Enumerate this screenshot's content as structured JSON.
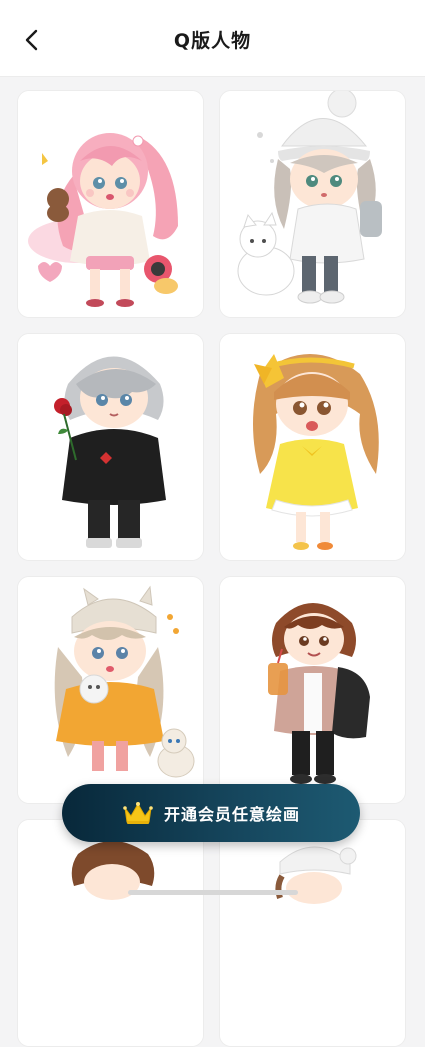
{
  "header": {
    "title": "Q版人物",
    "back_icon": "chevron-left-icon"
  },
  "gallery": {
    "items": [
      {
        "name": "pink-hair-girl-with-teddy"
      },
      {
        "name": "white-beanie-girl-with-cat"
      },
      {
        "name": "silver-hair-boy-with-rose"
      },
      {
        "name": "blonde-girl-yellow-dress"
      },
      {
        "name": "beige-hat-girl-with-kitten"
      },
      {
        "name": "brown-hair-boy-with-bubble-tea"
      },
      {
        "name": "brown-curly-hair-character"
      },
      {
        "name": "white-hat-character"
      }
    ]
  },
  "vip_banner": {
    "label": "开通会员任意绘画",
    "icon": "crown-icon"
  },
  "colors": {
    "accent_dark": "#08283a",
    "accent_teal": "#1d5a72",
    "crown": "#f5c518"
  }
}
